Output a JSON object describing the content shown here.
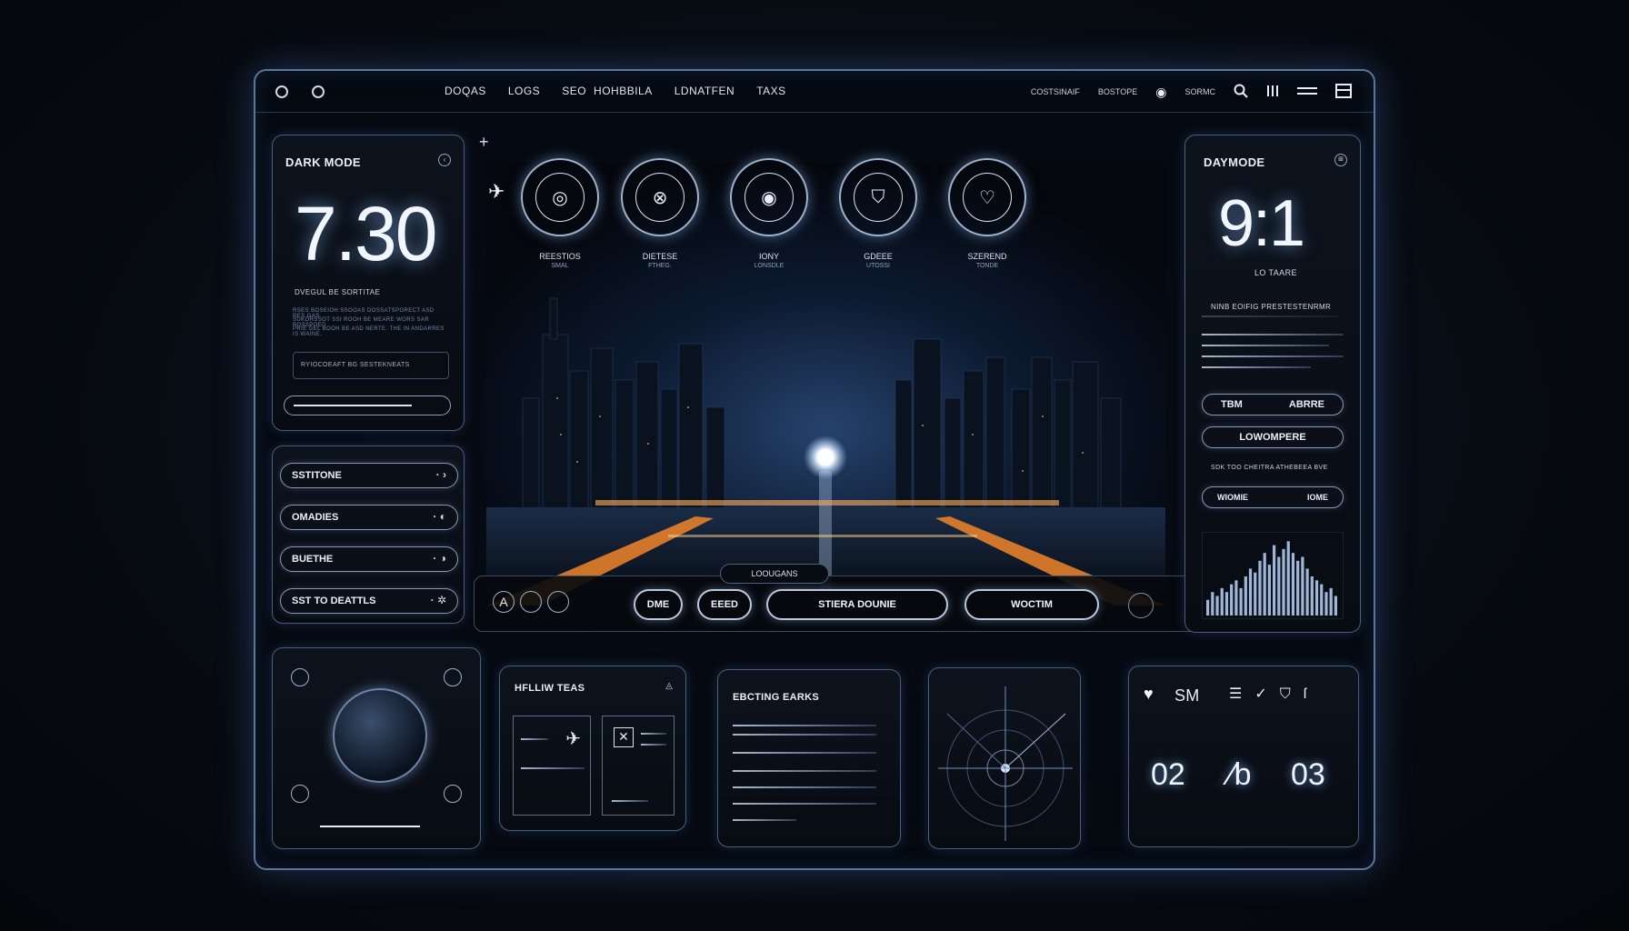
{
  "topbar": {
    "nav": [
      "DOQAS",
      "LOGS",
      "SEO",
      "HOHBBILA",
      "LDNATFEN",
      "TAXS"
    ],
    "right_items": [
      "COSTSINAIF",
      "BOSTOPE",
      "SORMC"
    ],
    "icons": [
      "search-icon",
      "columns-icon",
      "menu-icon",
      "layout-icon"
    ]
  },
  "left_panel": {
    "title": "DARK MODE",
    "time": "7.30",
    "subtitle": "DVEGUL  BE SORTITAE",
    "body_lines": [
      "RSES BOSEIOH SSOOAS DOSSATSPORECT ASD RES GAS",
      "SUKORSSOT SSI ROOH BE MEARE WORS SAR BOSSPOED",
      "PRIE GEL BOOH BE ASD NERTE. THE IN ANDARRES IS WAINE."
    ],
    "field_label": "RYIOCOEAFT  BG SESTEKNEATS"
  },
  "left_buttons": [
    "SSTITONE",
    "OMADIES",
    "BUETHE",
    "SST TO DEATTLS"
  ],
  "dials": [
    {
      "label": "REESTIOS",
      "sub": "SMAL",
      "icon": "target-icon"
    },
    {
      "label": "DIETESE",
      "sub": "FTHEG.",
      "icon": "close-icon"
    },
    {
      "label": "IONY",
      "sub": "LONSDLE",
      "icon": "target-icon"
    },
    {
      "label": "GDEEE",
      "sub": "UTOSSI",
      "icon": "shield-icon"
    },
    {
      "label": "SZEREND",
      "sub": "TONDE",
      "icon": "heart-icon"
    }
  ],
  "center_toolbar": {
    "tab_label": "LOOUGANS",
    "buttons": [
      "DME",
      "EEED",
      "STIERA DOUNIE",
      "WOCTIM"
    ]
  },
  "right_panel": {
    "title": "DAYMODE",
    "time": "9:1",
    "subtitle": "LO TAARE",
    "heading": "NINB EOIFIG  PRESTESTENRMR",
    "btn_row": [
      "TBM",
      "ABRRE"
    ],
    "btn_wide": "LOWOMPERE",
    "caption": "SDK TOO CHEITRA ATHEBEEA BVE",
    "toggle": [
      "WIOMIE",
      "IOME"
    ],
    "chart_bars": [
      0.2,
      0.3,
      0.25,
      0.35,
      0.3,
      0.4,
      0.45,
      0.35,
      0.5,
      0.6,
      0.55,
      0.7,
      0.8,
      0.65,
      0.9,
      0.75,
      0.85,
      0.95,
      0.8,
      0.7,
      0.75,
      0.6,
      0.5,
      0.45,
      0.4,
      0.3,
      0.35,
      0.25
    ]
  },
  "bottom": {
    "panel2_title": "HFLLIW TEAS",
    "panel3_title": "EBCTING EARKS",
    "panel5_title": "SM",
    "digits": [
      "02",
      "⁄b",
      "03"
    ]
  },
  "colors": {
    "accent": "#8fb6ff",
    "glow": "#5b86d6",
    "orange": "#ff9a3c"
  }
}
